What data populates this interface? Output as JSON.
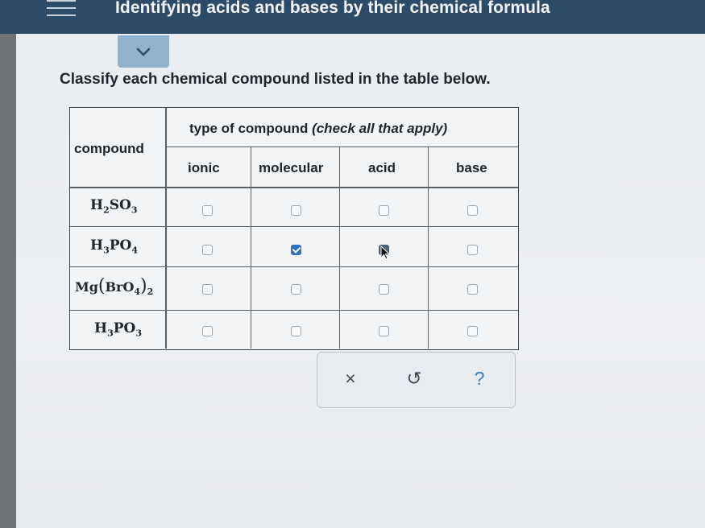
{
  "header": {
    "title": "Identifying acids and bases by their chemical formula",
    "menu_icon": "hamburger-icon",
    "expand_icon": "chevron-down-icon"
  },
  "question": {
    "instruction": "Classify each chemical compound listed in the table below.",
    "table": {
      "compound_header": "compound",
      "group_header": "type of compound",
      "group_header_note": "(check all that apply)",
      "columns": [
        "ionic",
        "molecular",
        "acid",
        "base"
      ],
      "rows": [
        {
          "formula_parts": [
            "H",
            "2",
            "SO",
            "3"
          ],
          "checked": [
            false,
            false,
            false,
            false
          ]
        },
        {
          "formula_parts": [
            "H",
            "3",
            "PO",
            "4"
          ],
          "checked": [
            false,
            true,
            false,
            false
          ]
        },
        {
          "formula_parts": [
            "Mg",
            "(",
            "BrO",
            "4",
            ")",
            "2"
          ],
          "checked": [
            false,
            false,
            false,
            false
          ]
        },
        {
          "formula_parts": [
            "H",
            "3",
            "PO",
            "3"
          ],
          "checked": [
            false,
            false,
            false,
            false
          ]
        }
      ]
    }
  },
  "actions": {
    "clear": "×",
    "undo": "↺",
    "help": "?"
  },
  "colors": {
    "header_bg": "#2d4a66",
    "checkbox_checked": "#2f6fbd",
    "help_blue": "#3b7fc3"
  }
}
